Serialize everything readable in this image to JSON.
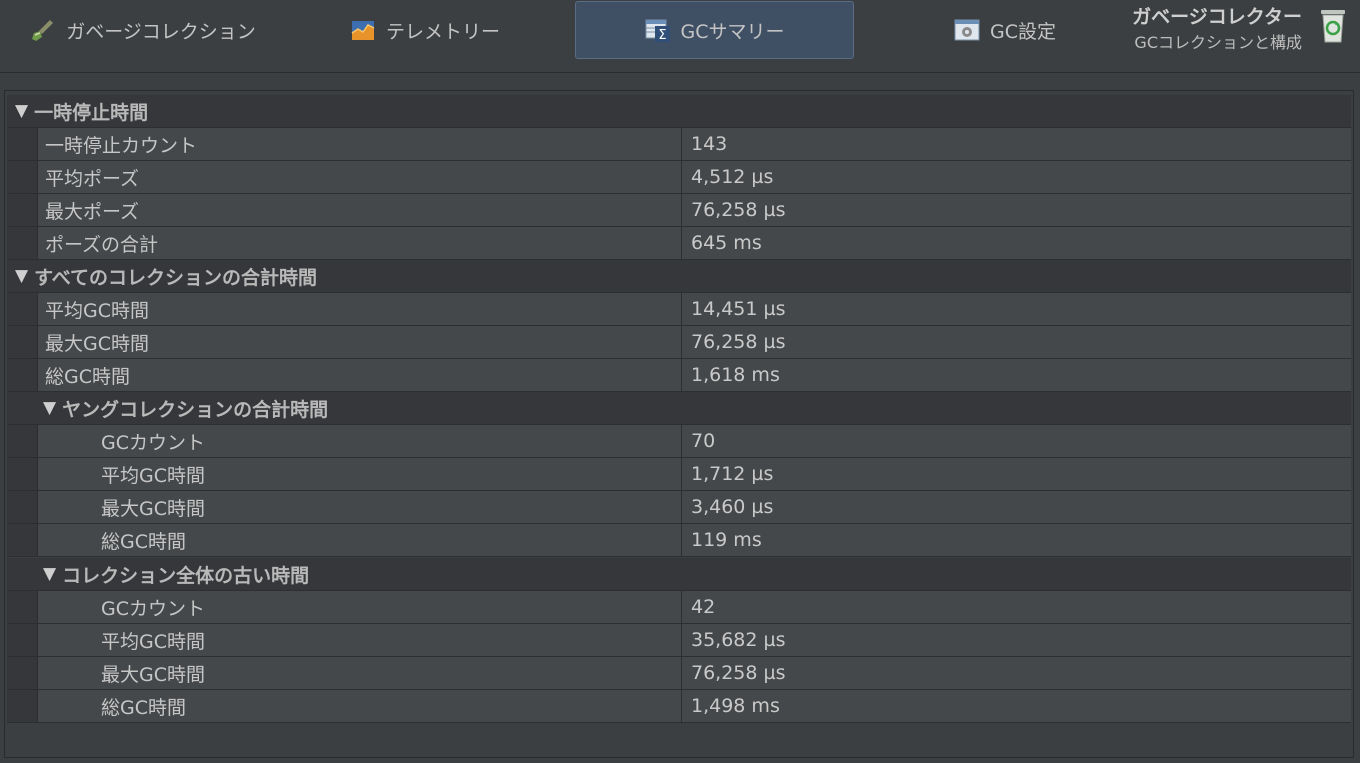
{
  "tabs": [
    {
      "label": "ガベージコレクション",
      "icon": "broom-icon"
    },
    {
      "label": "テレメトリー",
      "icon": "chart-icon"
    },
    {
      "label": "GCサマリー",
      "icon": "sigma-table-icon"
    },
    {
      "label": "GC設定",
      "icon": "gear-icon"
    }
  ],
  "header": {
    "title": "ガベージコレクター",
    "subtitle": "GCコレクションと構成"
  },
  "groups": {
    "pause": {
      "title": "一時停止時間",
      "rows": [
        {
          "label": "一時停止カウント",
          "value": "143"
        },
        {
          "label": "平均ポーズ",
          "value": "4,512 µs"
        },
        {
          "label": "最大ポーズ",
          "value": "76,258 µs"
        },
        {
          "label": "ポーズの合計",
          "value": "645 ms"
        }
      ]
    },
    "all": {
      "title": "すべてのコレクションの合計時間",
      "rows": [
        {
          "label": "平均GC時間",
          "value": "14,451 µs"
        },
        {
          "label": "最大GC時間",
          "value": "76,258 µs"
        },
        {
          "label": "総GC時間",
          "value": "1,618 ms"
        }
      ]
    },
    "young": {
      "title": "ヤングコレクションの合計時間",
      "rows": [
        {
          "label": "GCカウント",
          "value": "70"
        },
        {
          "label": "平均GC時間",
          "value": "1,712 µs"
        },
        {
          "label": "最大GC時間",
          "value": "3,460 µs"
        },
        {
          "label": "総GC時間",
          "value": "119 ms"
        }
      ]
    },
    "old": {
      "title": "コレクション全体の古い時間",
      "rows": [
        {
          "label": "GCカウント",
          "value": "42"
        },
        {
          "label": "平均GC時間",
          "value": "35,682 µs"
        },
        {
          "label": "最大GC時間",
          "value": "76,258 µs"
        },
        {
          "label": "総GC時間",
          "value": "1,498 ms"
        }
      ]
    }
  },
  "colors": {
    "background": "#3c3f41",
    "active_tab": "#405064",
    "cell": "#45484a"
  }
}
